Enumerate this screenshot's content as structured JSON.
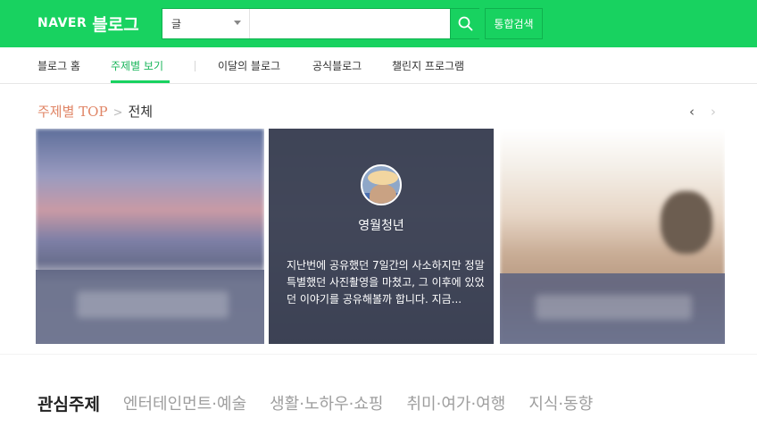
{
  "header": {
    "logo_naver": "NAVER",
    "logo_blog": "블로그",
    "search": {
      "select_label": "글",
      "input_value": "",
      "input_placeholder": ""
    },
    "total_search_label": "통합검색"
  },
  "nav": {
    "items": [
      {
        "label": "블로그 홈"
      },
      {
        "label": "주제별 보기"
      },
      {
        "label": "이달의 블로그"
      },
      {
        "label": "공식블로그"
      },
      {
        "label": "챌린지 프로그램"
      }
    ],
    "active_index": 1
  },
  "topic": {
    "breadcrumb_root": "주제별 TOP",
    "breadcrumb_separator": ">",
    "breadcrumb_current": "전체",
    "arrow_prev": "‹",
    "arrow_next": "›",
    "featured": {
      "author": "영월청년",
      "excerpt": "지난번에 공유했던 7일간의 사소하지만 정말 특별했던 사진촬영을 마쳤고, 그 이후에 있었던 이야기를 공유해볼까 합니다. 지금..."
    }
  },
  "interest": {
    "title": "관심주제",
    "tabs": [
      "엔터테인먼트·예술",
      "생활·노하우·쇼핑",
      "취미·여가·여행",
      "지식·동향"
    ]
  },
  "colors": {
    "brand": "#18d260",
    "breadcrumb_accent": "#e08566",
    "nav_active": "#18b55a"
  }
}
